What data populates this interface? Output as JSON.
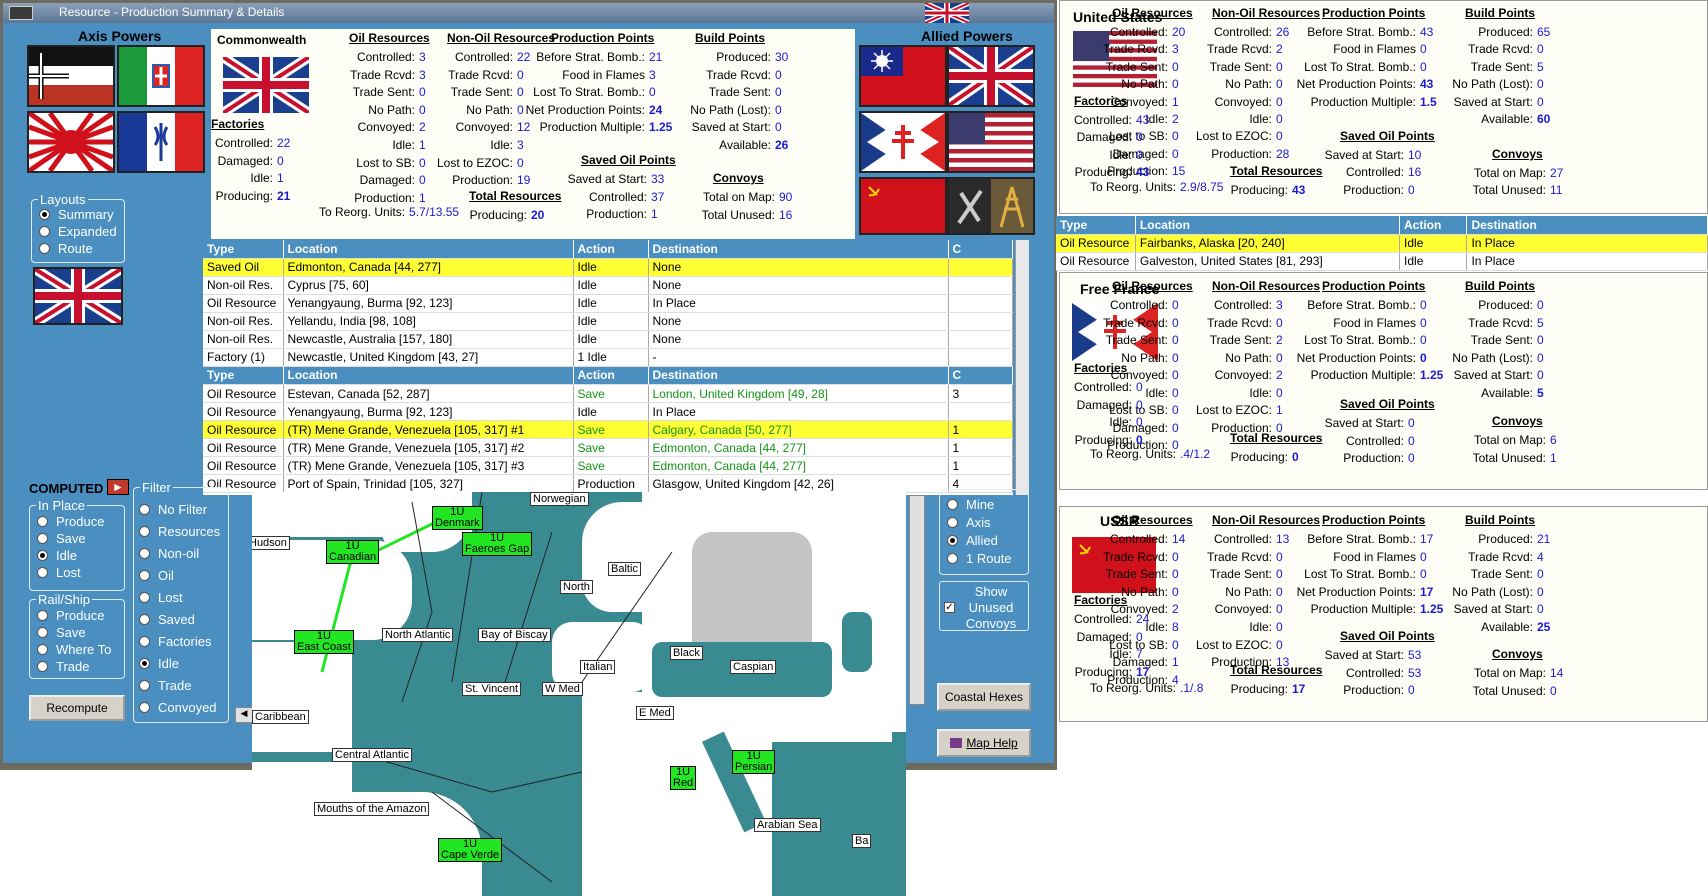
{
  "window": {
    "title": "Resource - Production Summary & Details"
  },
  "colors": {
    "panel_bg": "#4a8fc0",
    "highlight": "#ffff33",
    "value": "#1a1ad0",
    "convoy": "#22e622",
    "sea": "#3a8a92"
  },
  "axis_title": "Axis Powers",
  "allied_title": "Allied Powers",
  "commonwealth": {
    "name": "Commonwealth",
    "oil": {
      "title": "Oil Resources",
      "rows": [
        [
          "Controlled:",
          "3"
        ],
        [
          "Trade Rcvd:",
          "3"
        ],
        [
          "Trade Sent:",
          "0"
        ],
        [
          "No Path:",
          "0"
        ],
        [
          "Convoyed:",
          "2"
        ],
        [
          "Idle:",
          "1"
        ],
        [
          "Lost to SB:",
          "0"
        ],
        [
          "Damaged:",
          "0"
        ],
        [
          "Production:",
          "1"
        ]
      ]
    },
    "nonoil": {
      "title": "Non-Oil Resources",
      "rows": [
        [
          "Controlled:",
          "22"
        ],
        [
          "Trade Rcvd:",
          "0"
        ],
        [
          "Trade Sent:",
          "0"
        ],
        [
          "No Path:",
          "0"
        ],
        [
          "Convoyed:",
          "12"
        ],
        [
          "Idle:",
          "3"
        ],
        [
          "Lost to EZOC:",
          "0"
        ],
        [
          "Production:",
          "19"
        ]
      ]
    },
    "pp": {
      "title": "Production Points",
      "rows": [
        [
          "Before Strat. Bomb.:",
          "21"
        ],
        [
          "Food in Flames",
          "3"
        ],
        [
          "Lost To Strat. Bomb.:",
          "0"
        ],
        [
          "Net Production Points:",
          "24"
        ],
        [
          "Production Multiple:",
          "1.25"
        ]
      ]
    },
    "bp": {
      "title": "Build Points",
      "rows": [
        [
          "Produced:",
          "30"
        ],
        [
          "Trade Rcvd:",
          "0"
        ],
        [
          "Trade Sent:",
          "0"
        ],
        [
          "No Path (Lost):",
          "0"
        ],
        [
          "Saved at Start:",
          "0"
        ],
        [
          "Available:",
          "26"
        ]
      ]
    },
    "factories": {
      "title": "Factories",
      "rows": [
        [
          "Controlled:",
          "22"
        ],
        [
          "Damaged:",
          "0"
        ],
        [
          "Idle:",
          "1"
        ],
        [
          "Producing:",
          "21"
        ]
      ]
    },
    "saved": {
      "title": "Saved Oil Points",
      "rows": [
        [
          "Saved at Start:",
          "33"
        ],
        [
          "Controlled:",
          "37"
        ],
        [
          "Production:",
          "1"
        ]
      ]
    },
    "convoys": {
      "title": "Convoys",
      "rows": [
        [
          "Total on Map:",
          "90"
        ],
        [
          "Total Unused:",
          "16"
        ]
      ]
    },
    "total": {
      "title": "Total Resources",
      "label": "Producing:",
      "value": "20"
    },
    "reorg": {
      "label": "To Reorg. Units:",
      "value": "5.7/13.55"
    }
  },
  "layouts": {
    "title": "Layouts",
    "options": [
      "Summary",
      "Expanded",
      "Route"
    ],
    "selected": 0
  },
  "computed_label": "COMPUTED",
  "inplace": {
    "title": "In Place",
    "options": [
      "Produce",
      "Save",
      "Idle",
      "Lost"
    ],
    "selected": 2
  },
  "railship": {
    "title": "Rail/Ship",
    "options": [
      "Produce",
      "Save",
      "Where To",
      "Trade"
    ]
  },
  "filter": {
    "title": "Filter",
    "options": [
      "No Filter",
      "Resources",
      "Non-oil",
      "Oil",
      "Lost",
      "Saved",
      "Factories",
      "Idle",
      "Trade",
      "Convoyed"
    ],
    "selected": 7
  },
  "recompute": "Recompute",
  "scope": {
    "options": [
      "Mine",
      "Axis",
      "Allied",
      "1 Route"
    ],
    "selected": 2
  },
  "show_unused": "Show Unused Convoys",
  "coastal": "Coastal Hexes",
  "maphelp": "Map Help",
  "table1": {
    "headers": [
      "Type",
      "Location",
      "Action",
      "Destination",
      "C"
    ],
    "rows": [
      [
        "Saved Oil",
        "Edmonton, Canada [44, 277]",
        "Idle",
        "None",
        ""
      ],
      [
        "Non-oil Res.",
        "Cyprus [75, 60]",
        "Idle",
        "None",
        ""
      ],
      [
        "Oil Resource",
        "Yenangyaung, Burma [92, 123]",
        "Idle",
        "In Place",
        ""
      ],
      [
        "Non-oil Res.",
        "Yellandu, India [98, 108]",
        "Idle",
        "None",
        ""
      ],
      [
        "Non-oil Res.",
        "Newcastle, Australia [157, 180]",
        "Idle",
        "None",
        ""
      ],
      [
        "Factory (1)",
        "Newcastle, United Kingdom [43, 27]",
        "1 Idle",
        "-",
        ""
      ]
    ]
  },
  "table2": {
    "headers": [
      "Type",
      "Location",
      "Action",
      "Destination",
      "C"
    ],
    "rows": [
      [
        "Oil Resource",
        "Estevan, Canada [52, 287]",
        "Save",
        "London, United Kingdom [49, 28]",
        "3"
      ],
      [
        "Oil Resource",
        "Yenangyaung, Burma [92, 123]",
        "Idle",
        "In Place",
        ""
      ],
      [
        "Oil Resource",
        "(TR) Mene Grande, Venezuela [105, 317] #1",
        "Save",
        "Calgary, Canada [50, 277]",
        "1"
      ],
      [
        "Oil Resource",
        "(TR) Mene Grande, Venezuela [105, 317] #2",
        "Save",
        "Edmonton, Canada [44, 277]",
        "1"
      ],
      [
        "Oil Resource",
        "(TR) Mene Grande, Venezuela [105, 317] #3",
        "Save",
        "Edmonton, Canada [44, 277]",
        "1"
      ],
      [
        "Oil Resource",
        "Port of Spain, Trinidad [105, 327]",
        "Production",
        "Glasgow, United Kingdom [42, 26]",
        "4"
      ]
    ]
  },
  "map": {
    "seas": [
      "Norwegian",
      "Hudson",
      "Baltic",
      "North",
      "North Atlantic",
      "Bay of Biscay",
      "Black",
      "Caspian",
      "Italian",
      "St. Vincent",
      "W Med",
      "E Med",
      "Caribbean",
      "Central Atlantic",
      "Mouths of the Amazon",
      "Arabian Sea",
      "Ba"
    ],
    "convoys": [
      {
        "count": "1U",
        "name": "Denmark"
      },
      {
        "count": "1U",
        "name": "Canadian"
      },
      {
        "count": "1U",
        "name": "Faeroes Gap"
      },
      {
        "count": "1U",
        "name": "East Coast"
      },
      {
        "count": "1U",
        "name": "Red"
      },
      {
        "count": "1U",
        "name": "Persian"
      },
      {
        "count": "1U",
        "name": "Cape Verde"
      }
    ]
  },
  "us": {
    "name": "United States",
    "oil": {
      "title": "Oil Resources",
      "rows": [
        [
          "Controlled:",
          "20"
        ],
        [
          "Trade Rcvd:",
          "3"
        ],
        [
          "Trade Sent:",
          "0"
        ],
        [
          "No Path:",
          "0"
        ],
        [
          "Convoyed:",
          "1"
        ],
        [
          "Idle:",
          "2"
        ],
        [
          "Lost to SB:",
          "0"
        ],
        [
          "Damaged:",
          "0"
        ],
        [
          "Production:",
          "15"
        ]
      ]
    },
    "nonoil": {
      "title": "Non-Oil Resources",
      "rows": [
        [
          "Controlled:",
          "26"
        ],
        [
          "Trade Rcvd:",
          "2"
        ],
        [
          "Trade Sent:",
          "0"
        ],
        [
          "No Path:",
          "0"
        ],
        [
          "Convoyed:",
          "0"
        ],
        [
          "Idle:",
          "0"
        ],
        [
          "Lost to EZOC:",
          "0"
        ],
        [
          "Production:",
          "28"
        ]
      ]
    },
    "pp": {
      "title": "Production Points",
      "rows": [
        [
          "Before Strat. Bomb.:",
          "43"
        ],
        [
          "Food in Flames",
          "0"
        ],
        [
          "Lost To Strat. Bomb.:",
          "0"
        ],
        [
          "Net Production Points:",
          "43"
        ],
        [
          "Production Multiple:",
          "1.5"
        ]
      ]
    },
    "bp": {
      "title": "Build Points",
      "rows": [
        [
          "Produced:",
          "65"
        ],
        [
          "Trade Rcvd:",
          "0"
        ],
        [
          "Trade Sent:",
          "5"
        ],
        [
          "No Path (Lost):",
          "0"
        ],
        [
          "Saved at Start:",
          "0"
        ],
        [
          "Available:",
          "60"
        ]
      ]
    },
    "factories": {
      "title": "Factories",
      "rows": [
        [
          "Controlled:",
          "43"
        ],
        [
          "Damaged:",
          "0"
        ],
        [
          "Idle:",
          "0"
        ],
        [
          "Producing:",
          "43"
        ]
      ]
    },
    "saved": {
      "title": "Saved Oil Points",
      "rows": [
        [
          "Saved at Start:",
          "10"
        ],
        [
          "Controlled:",
          "16"
        ],
        [
          "Production:",
          "0"
        ]
      ]
    },
    "convoys": {
      "title": "Convoys",
      "rows": [
        [
          "Total on Map:",
          "27"
        ],
        [
          "Total Unused:",
          "11"
        ]
      ]
    },
    "total": {
      "title": "Total Resources",
      "label": "Producing:",
      "value": "43"
    },
    "reorg": {
      "label": "To Reorg. Units:",
      "value": "2.9/8.75"
    }
  },
  "table3": {
    "headers": [
      "Type",
      "Location",
      "Action",
      "Destination"
    ],
    "rows": [
      [
        "Oil Resource",
        "Fairbanks, Alaska [20, 240]",
        "Idle",
        "In Place"
      ],
      [
        "Oil Resource",
        "Galveston, United States [81, 293]",
        "Idle",
        "In Place"
      ]
    ]
  },
  "ff": {
    "name": "Free France",
    "oil": {
      "title": "Oil Resources",
      "rows": [
        [
          "Controlled:",
          "0"
        ],
        [
          "Trade Rcvd:",
          "0"
        ],
        [
          "Trade Sent:",
          "0"
        ],
        [
          "No Path:",
          "0"
        ],
        [
          "Convoyed:",
          "0"
        ],
        [
          "Idle:",
          "0"
        ],
        [
          "Lost to SB:",
          "0"
        ],
        [
          "Damaged:",
          "0"
        ],
        [
          "Production:",
          "0"
        ]
      ]
    },
    "nonoil": {
      "title": "Non-Oil Resources",
      "rows": [
        [
          "Controlled:",
          "3"
        ],
        [
          "Trade Rcvd:",
          "0"
        ],
        [
          "Trade Sent:",
          "2"
        ],
        [
          "No Path:",
          "0"
        ],
        [
          "Convoyed:",
          "2"
        ],
        [
          "Idle:",
          "0"
        ],
        [
          "Lost to EZOC:",
          "1"
        ],
        [
          "Production:",
          "0"
        ]
      ]
    },
    "pp": {
      "title": "Production Points",
      "rows": [
        [
          "Before Strat. Bomb.:",
          "0"
        ],
        [
          "Food in Flames",
          "0"
        ],
        [
          "Lost To Strat. Bomb.:",
          "0"
        ],
        [
          "Net Production Points:",
          "0"
        ],
        [
          "Production Multiple:",
          "1.25"
        ]
      ]
    },
    "bp": {
      "title": "Build Points",
      "rows": [
        [
          "Produced:",
          "0"
        ],
        [
          "Trade Rcvd:",
          "5"
        ],
        [
          "Trade Sent:",
          "0"
        ],
        [
          "No Path (Lost):",
          "0"
        ],
        [
          "Saved at Start:",
          "0"
        ],
        [
          "Available:",
          "5"
        ]
      ]
    },
    "factories": {
      "title": "Factories",
      "rows": [
        [
          "Controlled:",
          "0"
        ],
        [
          "Damaged:",
          "0"
        ],
        [
          "Idle:",
          "0"
        ],
        [
          "Producing:",
          "0"
        ]
      ]
    },
    "saved": {
      "title": "Saved Oil Points",
      "rows": [
        [
          "Saved at Start:",
          "0"
        ],
        [
          "Controlled:",
          "0"
        ],
        [
          "Production:",
          "0"
        ]
      ]
    },
    "convoys": {
      "title": "Convoys",
      "rows": [
        [
          "Total on Map:",
          "6"
        ],
        [
          "Total Unused:",
          "1"
        ]
      ]
    },
    "total": {
      "title": "Total Resources",
      "label": "Producing:",
      "value": "0"
    },
    "reorg": {
      "label": "To Reorg. Units:",
      "value": ".4/1.2"
    }
  },
  "ussr": {
    "name": "USSR",
    "oil": {
      "title": "Oil Resources",
      "rows": [
        [
          "Controlled:",
          "14"
        ],
        [
          "Trade Rcvd:",
          "0"
        ],
        [
          "Trade Sent:",
          "0"
        ],
        [
          "No Path:",
          "0"
        ],
        [
          "Convoyed:",
          "2"
        ],
        [
          "Idle:",
          "8"
        ],
        [
          "Lost to SB:",
          "0"
        ],
        [
          "Damaged:",
          "1"
        ],
        [
          "Production:",
          "4"
        ]
      ]
    },
    "nonoil": {
      "title": "Non-Oil Resources",
      "rows": [
        [
          "Controlled:",
          "13"
        ],
        [
          "Trade Rcvd:",
          "0"
        ],
        [
          "Trade Sent:",
          "0"
        ],
        [
          "No Path:",
          "0"
        ],
        [
          "Convoyed:",
          "0"
        ],
        [
          "Idle:",
          "0"
        ],
        [
          "Lost to EZOC:",
          "0"
        ],
        [
          "Production:",
          "13"
        ]
      ]
    },
    "pp": {
      "title": "Production Points",
      "rows": [
        [
          "Before Strat. Bomb.:",
          "17"
        ],
        [
          "Food in Flames",
          "0"
        ],
        [
          "Lost To Strat. Bomb.:",
          "0"
        ],
        [
          "Net Production Points:",
          "17"
        ],
        [
          "Production Multiple:",
          "1.25"
        ]
      ]
    },
    "bp": {
      "title": "Build Points",
      "rows": [
        [
          "Produced:",
          "21"
        ],
        [
          "Trade Rcvd:",
          "4"
        ],
        [
          "Trade Sent:",
          "0"
        ],
        [
          "No Path (Lost):",
          "0"
        ],
        [
          "Saved at Start:",
          "0"
        ],
        [
          "Available:",
          "25"
        ]
      ]
    },
    "factories": {
      "title": "Factories",
      "rows": [
        [
          "Controlled:",
          "24"
        ],
        [
          "Damaged:",
          "0"
        ],
        [
          "Idle:",
          "7"
        ],
        [
          "Producing:",
          "17"
        ]
      ]
    },
    "saved": {
      "title": "Saved Oil Points",
      "rows": [
        [
          "Saved at Start:",
          "53"
        ],
        [
          "Controlled:",
          "53"
        ],
        [
          "Production:",
          "0"
        ]
      ]
    },
    "convoys": {
      "title": "Convoys",
      "rows": [
        [
          "Total on Map:",
          "14"
        ],
        [
          "Total Unused:",
          "0"
        ]
      ]
    },
    "total": {
      "title": "Total Resources",
      "label": "Producing:",
      "value": "17"
    },
    "reorg": {
      "label": "To Reorg. Units:",
      "value": ".1/.8"
    }
  }
}
